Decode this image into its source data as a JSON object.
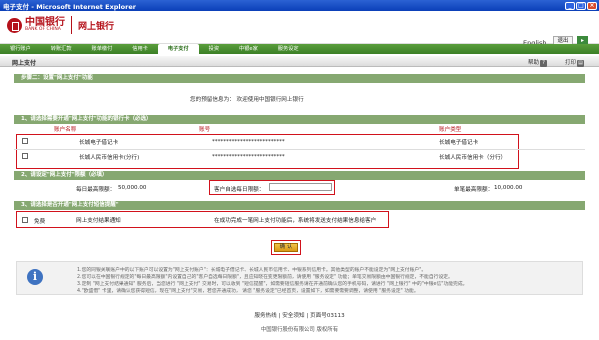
{
  "window": {
    "title": "电子支付 - Microsoft Internet Explorer"
  },
  "header": {
    "logo_cn": "中国银行",
    "logo_en": "BANK OF CHINA",
    "site_title": "网上银行",
    "language": "English",
    "logout": "退出"
  },
  "nav": {
    "items": [
      "银行账户",
      "转账汇款",
      "账单缴付",
      "信用卡",
      "电子支付",
      "投资",
      "中银e家",
      "服务设定"
    ]
  },
  "subbar": {
    "title": "网上支付",
    "help": "帮助",
    "print": "打印"
  },
  "step": {
    "title": "步骤二：设置\"网上支付\"功能",
    "greeting_label": "您的预留信息为：",
    "greeting_value": "欢迎使用中国银行网上银行"
  },
  "section1": {
    "title": "1、请选择需要开通\"网上支付\"功能的银行卡（必选）",
    "headers": [
      "账户名称",
      "账号",
      "账户类型"
    ],
    "rows": [
      {
        "name": "长城电子借记卡",
        "account": "**************************",
        "type": "长城电子借记卡"
      },
      {
        "name": "长城人民币信用卡(分行)",
        "account": "**************************",
        "type": "长城人民币信用卡（分行）"
      }
    ]
  },
  "section2": {
    "title": "2、请设定\"网上支付\"限额（必填）",
    "daily_label": "每日最高限额：",
    "daily_value": "50,000.00",
    "custom_label": "客户自选每日限额：",
    "custom_value": "",
    "single_label": "单笔最高限额：",
    "single_value": "10,000.00"
  },
  "section3": {
    "title": "3、请选择是否开通\"网上支付短信提醒\"",
    "free": "免费",
    "name": "网上支付结果通知",
    "desc": "在成功完成一笔网上支付功能后，系统将发送支付结果信息给客户"
  },
  "confirm": "确  认",
  "notes": [
    "1.您的同银关联账户中的以下账户可以设置为\"网上支付账户\"：长城电子借记卡、长城人民币信用卡、中银系列信用卡。其他类型的账户不能设定为\"网上支付账户\"。",
    "2.您可以在中国银行规定的\"每日最高限额\"内设置自己的\"客户自选每日限额\"，且应知晓在变更限额前，请使用 \"服务设定\" 功能；单笔交易限额由中国银行规定，不能自行设定。",
    "3.定制 \"网上支付结果通知\" 服务后，当您进行 \"网上支付\" 交易时，可以收到 \"短信提醒\"，如需要短信服务请在开通前确认您的手机号码，请进行 \"网上银行\" 中的\"中银e信\"功能完成。",
    "4.\"欧盛借\" 卡里，请确认您获得短信，现在\"网上支付\"交易，若您开通成功， 请您 \"服务设定\"已经首页，设置如下，如需要需要调整，请使用 \"服务设定\" 功能。"
  ],
  "footer": {
    "links": [
      "服务热线",
      "安全须知",
      "页面号03113"
    ],
    "copyright": "中国银行股份有限公司 版权所有"
  },
  "colors": {
    "brand_red": "#b5121b",
    "nav_green": "#4a8f2f",
    "section_green": "#86a871",
    "highlight_red": "#d1121c"
  }
}
